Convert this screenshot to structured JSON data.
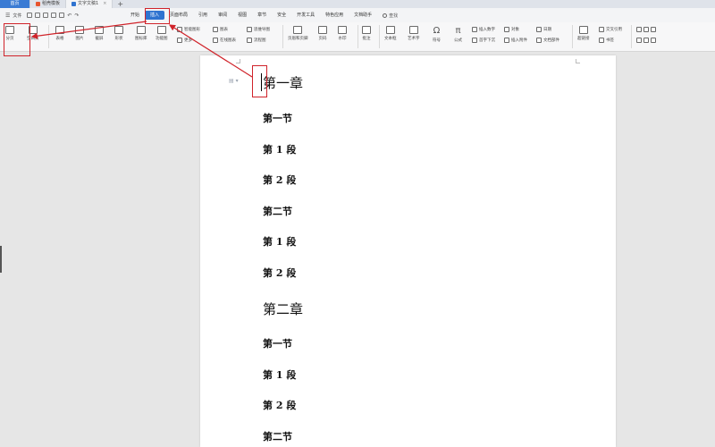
{
  "tabs": [
    {
      "label": "首页",
      "kind": "home"
    },
    {
      "label": "稻壳模板",
      "kind": "docer",
      "color": "#e8552e"
    },
    {
      "label": "文字文稿1",
      "kind": "doc",
      "color": "#2f73d0"
    }
  ],
  "quick_access": {
    "file_label": "文件"
  },
  "menu": [
    "开始",
    "插入",
    "页面布局",
    "引用",
    "审阅",
    "视图",
    "章节",
    "安全",
    "开发工具",
    "特色应用",
    "文档助手"
  ],
  "menu_active": "插入",
  "search_label": "查找",
  "ribbon": {
    "big_buttons": [
      {
        "label": "分页"
      },
      {
        "label": "空白页"
      },
      {
        "label": "表格"
      },
      {
        "label": "图片"
      },
      {
        "label": "截屏"
      },
      {
        "label": "形状"
      },
      {
        "label": "图标库"
      },
      {
        "label": "功能图"
      },
      {
        "label": "页眉和页脚"
      },
      {
        "label": "页码"
      },
      {
        "label": "水印"
      },
      {
        "label": "批注"
      },
      {
        "label": "文本框"
      },
      {
        "label": "艺术字"
      },
      {
        "label": "符号"
      },
      {
        "label": "公式"
      },
      {
        "label": "超链接"
      },
      {
        "label": "书签"
      }
    ],
    "small_buttons": [
      {
        "label": "智能图形"
      },
      {
        "label": "图表"
      },
      {
        "label": "思维导图"
      },
      {
        "label": "更多"
      },
      {
        "label": "在线图表"
      },
      {
        "label": "流程图"
      },
      {
        "label": "插入数字"
      },
      {
        "label": "对象"
      },
      {
        "label": "日期"
      },
      {
        "label": "首字下沉"
      },
      {
        "label": "插入附件"
      },
      {
        "label": "文档部件"
      },
      {
        "label": "交叉引用"
      }
    ]
  },
  "document": {
    "lines": [
      {
        "text": "第一章",
        "kind": "chapter"
      },
      {
        "text": "第一节",
        "kind": "section"
      },
      {
        "text": "第 1 段",
        "kind": "para"
      },
      {
        "text": "第 2 段",
        "kind": "para"
      },
      {
        "text": "第二节",
        "kind": "section"
      },
      {
        "text": "第 1 段",
        "kind": "para"
      },
      {
        "text": "第 2 段",
        "kind": "para"
      },
      {
        "text": "第二章",
        "kind": "chapter"
      },
      {
        "text": "第一节",
        "kind": "section"
      },
      {
        "text": "第 1 段",
        "kind": "para"
      },
      {
        "text": "第 2 段",
        "kind": "para"
      },
      {
        "text": "第二节",
        "kind": "section"
      }
    ]
  },
  "colors": {
    "accent": "#2f73d0",
    "annotation": "#d0232a"
  }
}
